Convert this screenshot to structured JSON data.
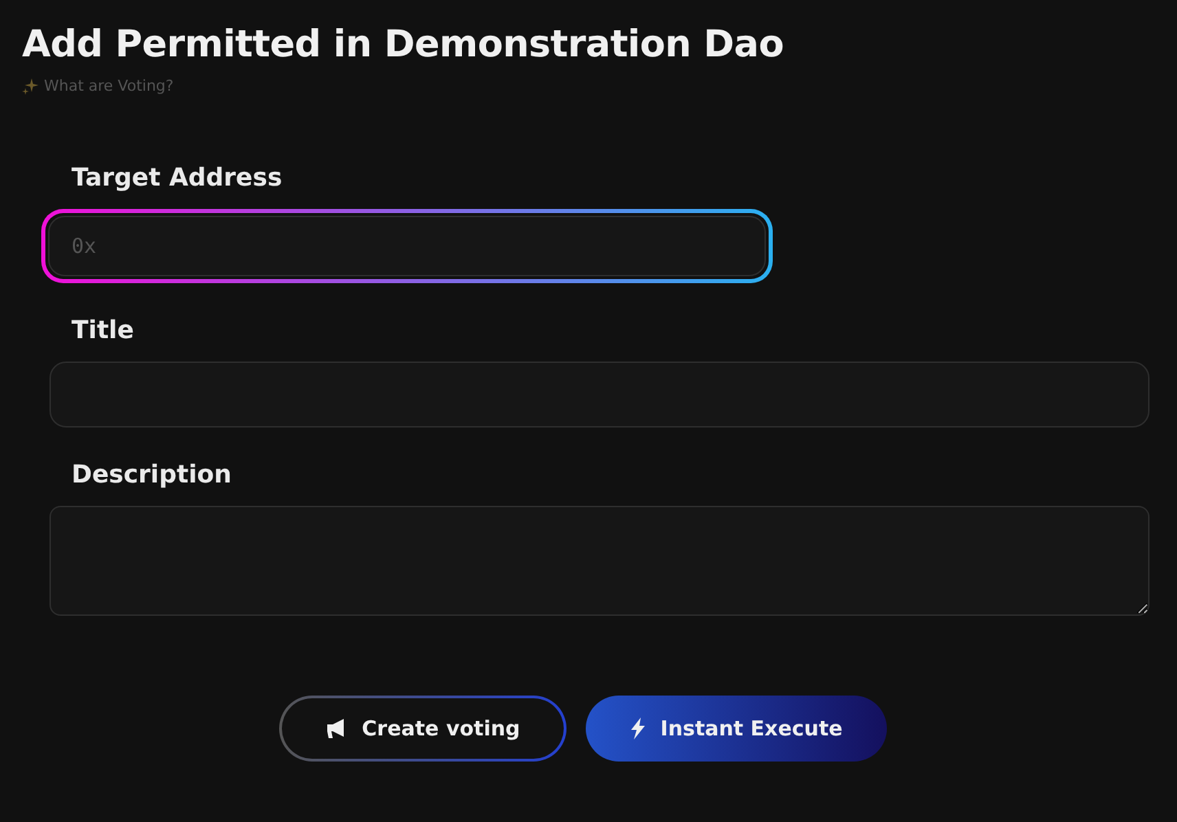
{
  "header": {
    "title": "Add Permitted in Demonstration Dao",
    "help_link": "What are Voting?"
  },
  "fields": [
    {
      "label": "Target Address",
      "kind": "input",
      "placeholder": "0x",
      "focused": true
    },
    {
      "label": "Title",
      "kind": "input",
      "focused": false
    },
    {
      "label": "Description",
      "kind": "textarea",
      "focused": false
    }
  ],
  "buttons": [
    {
      "label": "Create voting",
      "kind": "outline"
    },
    {
      "label": "Instant Execute",
      "kind": "primary"
    }
  ]
}
